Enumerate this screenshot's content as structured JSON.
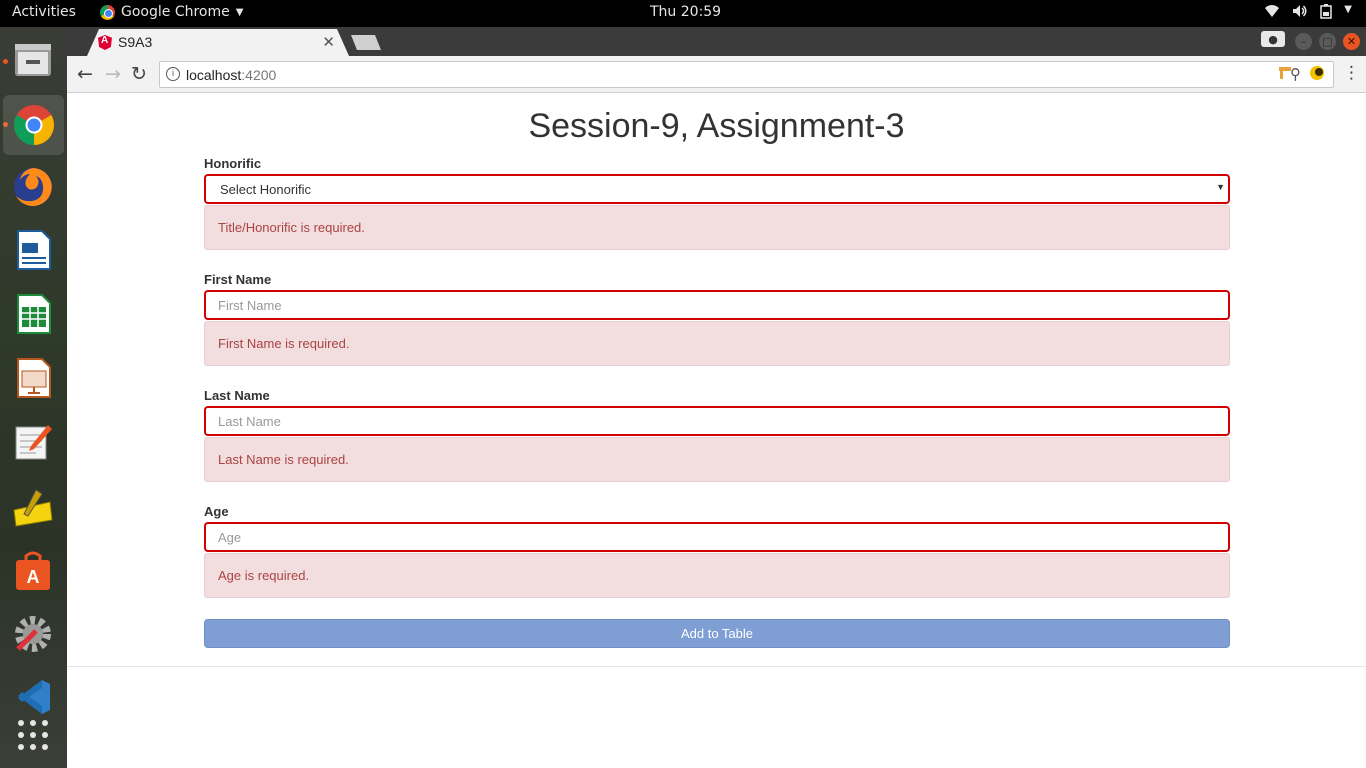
{
  "system": {
    "activities": "Activities",
    "app_name": "Google Chrome",
    "clock": "Thu 20:59"
  },
  "browser": {
    "tab_title": "S9A3",
    "url_host": "localhost",
    "url_port": ":4200"
  },
  "page": {
    "title": "Session-9, Assignment-3",
    "fields": [
      {
        "label": "Honorific",
        "value": "Select Honorific",
        "error": "Title/Honorific is required."
      },
      {
        "label": "First Name",
        "placeholder": "First Name",
        "error": "First Name is required."
      },
      {
        "label": "Last Name",
        "placeholder": "Last Name",
        "error": "Last Name is required."
      },
      {
        "label": "Age",
        "placeholder": "Age",
        "error": "Age is required."
      }
    ],
    "submit_label": "Add to Table"
  },
  "colors": {
    "error_border": "#d40000",
    "alert_bg": "#f2dede",
    "alert_text": "#a94442",
    "button_bg": "#7f9fd4",
    "dock_accent": "#e95420"
  },
  "dock_icons": [
    "files-icon",
    "chrome-icon",
    "firefox-icon",
    "writer-icon",
    "calc-icon",
    "impress-icon",
    "text-editor-icon",
    "notes-icon",
    "software-center-icon",
    "settings-icon",
    "vscode-icon",
    "app-grid-icon"
  ]
}
